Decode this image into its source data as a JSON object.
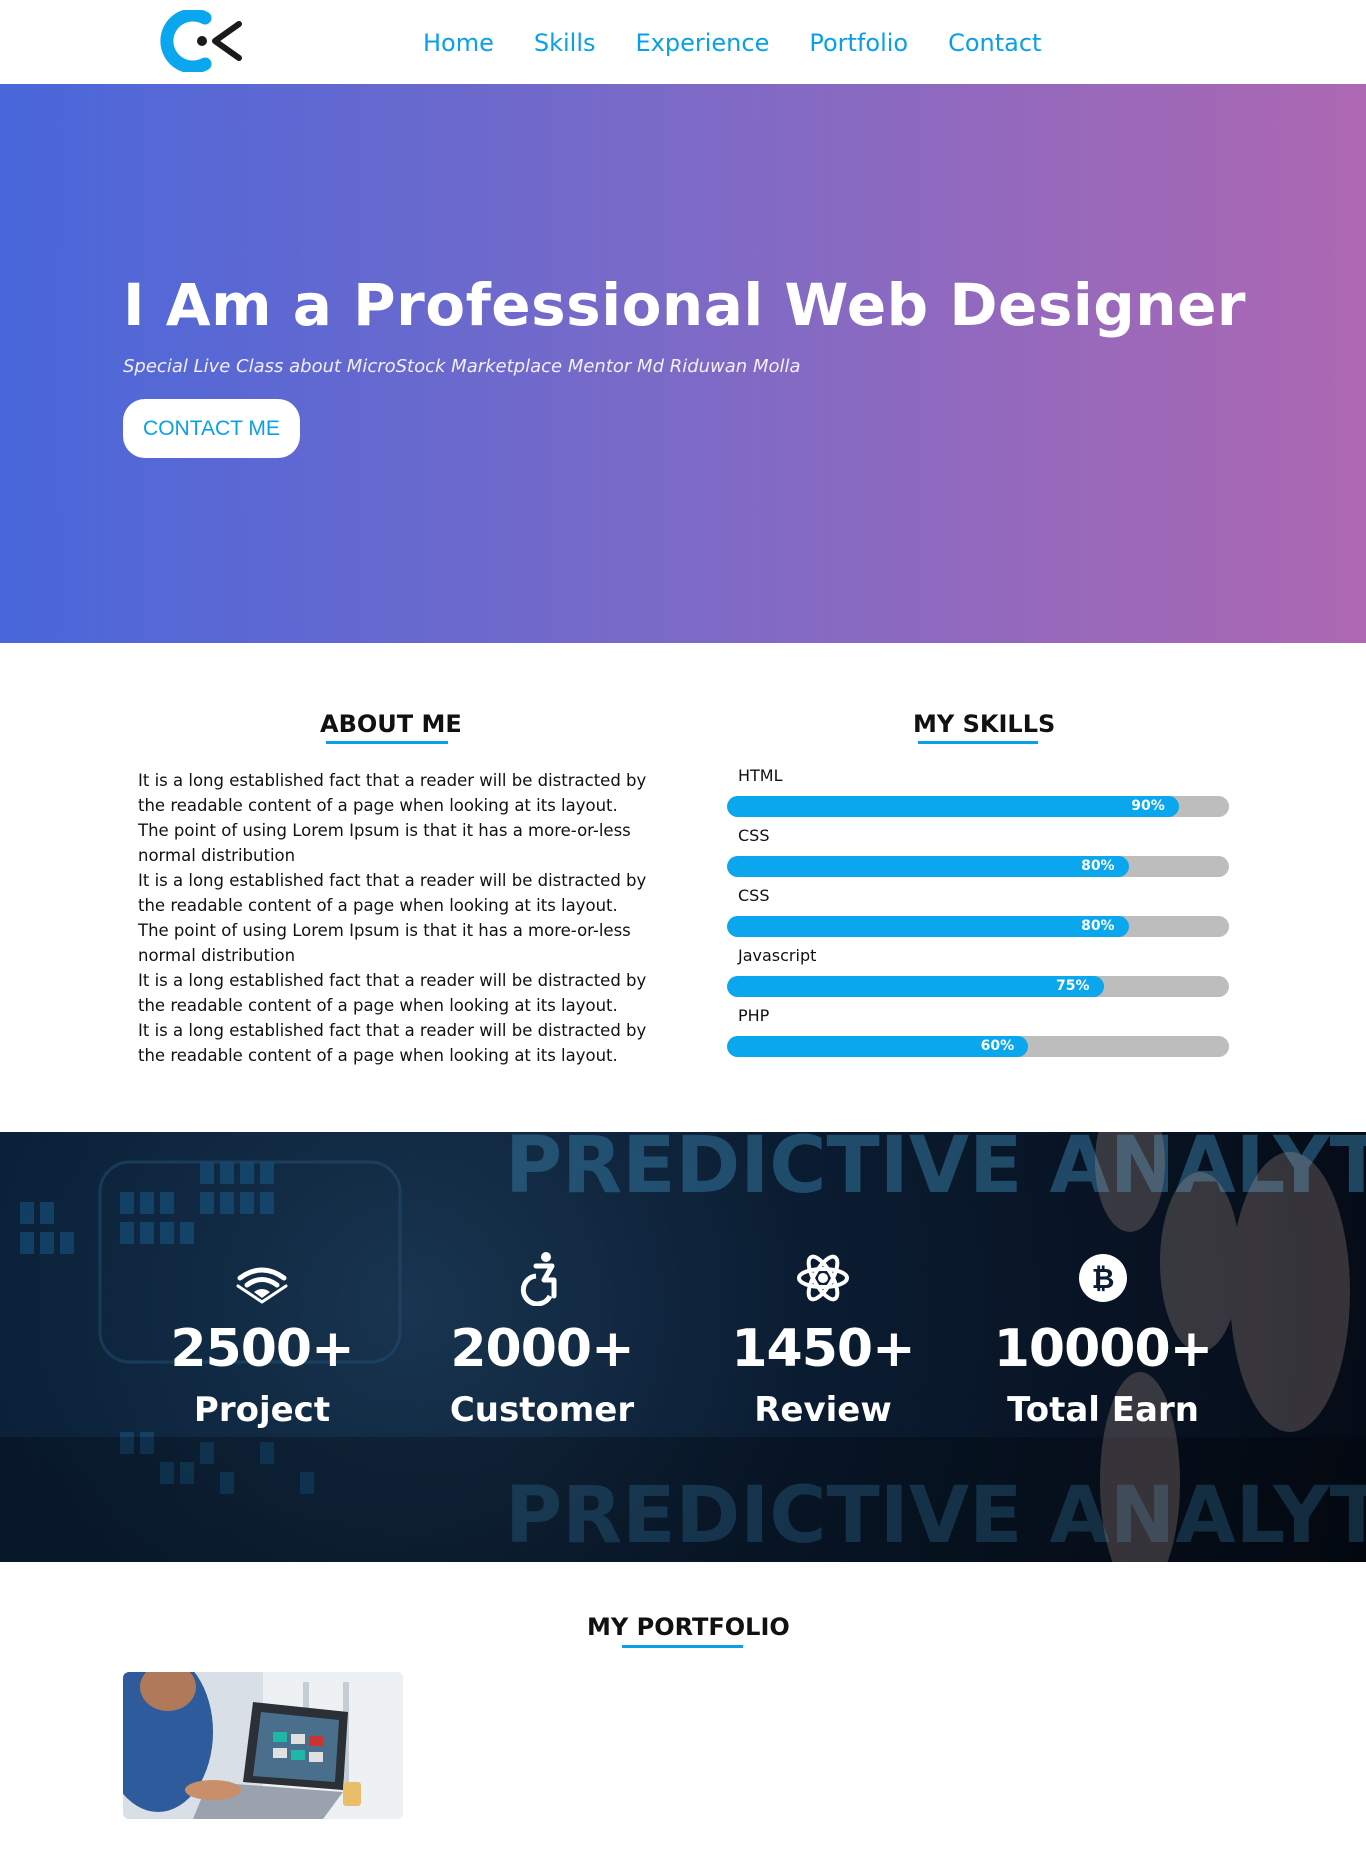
{
  "nav": {
    "logo_icon": "brand-logo-icon",
    "items": [
      {
        "label": "Home"
      },
      {
        "label": "Skills"
      },
      {
        "label": "Experience"
      },
      {
        "label": "Portfolio"
      },
      {
        "label": "Contact"
      }
    ]
  },
  "hero": {
    "title": "I Am a Professional Web Designer",
    "subtitle": "Special Live Class about MicroStock Marketplace Mentor Md Riduwan Molla",
    "button_label": "CONTACT ME",
    "gradient_start": "#4967da",
    "gradient_end": "#ad68b2"
  },
  "about": {
    "title": "ABOUT ME",
    "paragraphs": [
      "It is a long established fact that a reader will be distracted by the readable content of a page when looking at its layout. The point of using Lorem Ipsum is that it has a more-or-less normal distribution",
      "It is a long established fact that a reader will be distracted by the readable content of a page when looking at its layout. The point of using Lorem Ipsum is that it has a more-or-less normal distribution",
      "It is a long established fact that a reader will be distracted by the readable content of a page when looking at its layout.",
      "It is a long established fact that a reader will be distracted by the readable content of a page when looking at its layout."
    ]
  },
  "skills": {
    "title": "MY SKILLS",
    "items": [
      {
        "name": "HTML",
        "label": "90%",
        "value": 0.9
      },
      {
        "name": "CSS",
        "label": "80%",
        "value": 0.8
      },
      {
        "name": "CSS",
        "label": "80%",
        "value": 0.8
      },
      {
        "name": "Javascript",
        "label": "75%",
        "value": 0.75
      },
      {
        "name": "PHP",
        "label": "60%",
        "value": 0.6
      }
    ],
    "bar_color": "#0aa6ee",
    "track_color": "#bdbdbd"
  },
  "stats": {
    "items": [
      {
        "icon": "wifi-signal-icon",
        "number": "2500+",
        "label": "Project"
      },
      {
        "icon": "accessibility-icon",
        "number": "2000+",
        "label": "Customer"
      },
      {
        "icon": "atom-icon",
        "number": "1450+",
        "label": "Review"
      },
      {
        "icon": "bitcoin-icon",
        "number": "10000+",
        "label": "Total Earn"
      }
    ],
    "background_text": "PREDICTIVE ANALYTICS"
  },
  "portfolio": {
    "title": "MY PORTFOLIO",
    "thumbnail_icon": "laptop-photo-thumbnail"
  },
  "accent_color": "#0aa0e8"
}
